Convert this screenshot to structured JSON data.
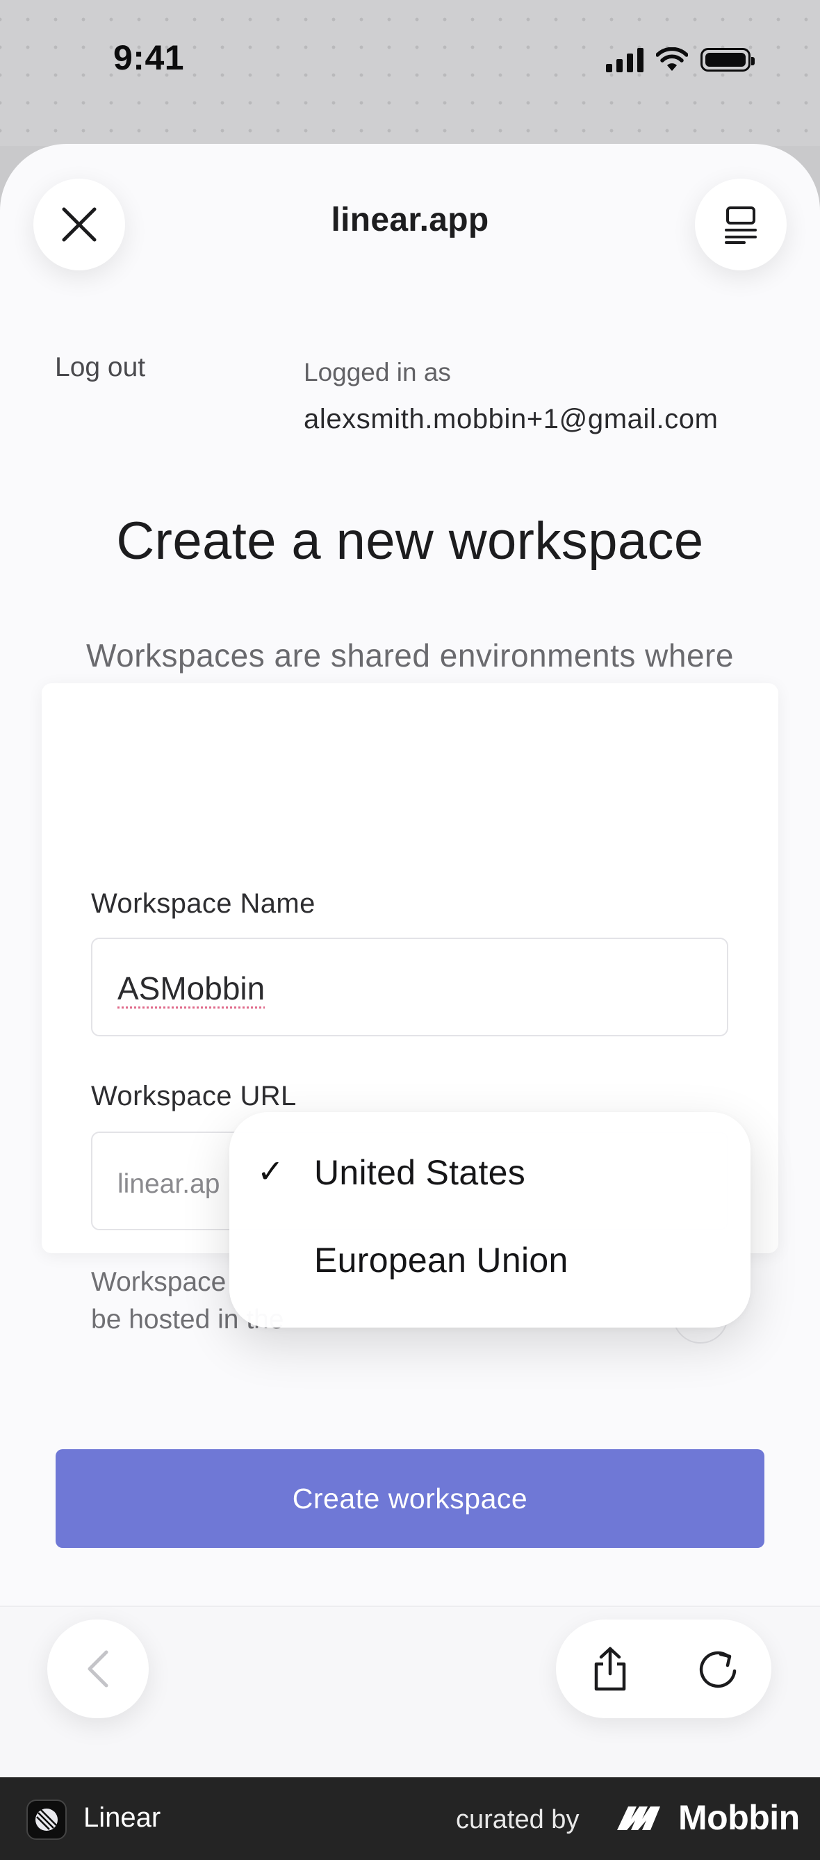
{
  "status_bar": {
    "time": "9:41"
  },
  "sheet": {
    "title": "linear.app",
    "logout_label": "Log out",
    "logged_in_label": "Logged in as",
    "logged_in_email": "alexsmith.mobbin+1@gmail.com"
  },
  "page": {
    "heading": "Create a new workspace",
    "description": "Workspaces are shared environments where teams can work on projects, cycles and issues."
  },
  "form": {
    "name_label": "Workspace Name",
    "name_value": "ASMobbin",
    "url_label": "Workspace URL",
    "url_prefix": "linear.ap",
    "hosted_text_line1": "Workspace",
    "hosted_text_line2": "be hosted in the"
  },
  "region_dropdown": {
    "options": [
      {
        "label": "United States",
        "selected": true
      },
      {
        "label": "European Union",
        "selected": false
      }
    ],
    "check_glyph": "✓"
  },
  "create_button": {
    "label": "Create workspace"
  },
  "footer": {
    "app_name": "Linear",
    "curated_by": "curated by",
    "brand": "Mobbin"
  },
  "icons": {
    "close": "close-icon",
    "reader": "reader-mode-icon",
    "back": "chevron-left-icon",
    "share": "share-icon",
    "reload": "reload-icon"
  },
  "colors": {
    "accent": "#6f78d6",
    "footer_bg": "#242424",
    "sheet_bg": "#fafafc"
  }
}
